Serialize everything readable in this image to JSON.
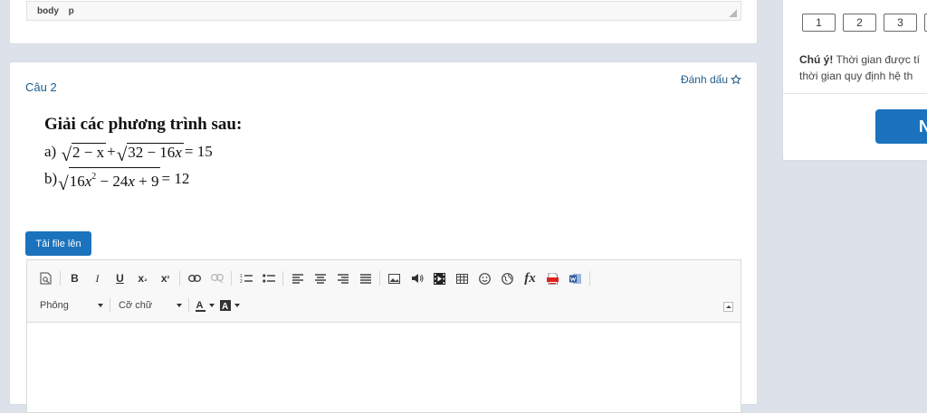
{
  "top_editor": {
    "path": [
      "body",
      "p"
    ]
  },
  "question": {
    "title": "Câu 2",
    "mark_label": "Đánh dấu",
    "heading": "Giải các phương trình sau:",
    "line_a": {
      "label": "a)",
      "r1": "2 − x",
      "plus": "+",
      "r2": "32 − 16",
      "r2_var": "x",
      "rhs": "= 15"
    },
    "line_b": {
      "label": "b)",
      "r1_a": "16",
      "r1_var": "x",
      "r1_exp": "2",
      "r1_b": " − 24",
      "r1_var2": "x",
      "r1_c": " + 9",
      "rhs": "= 12"
    }
  },
  "upload_label": "Tải file lên",
  "editor": {
    "font_combo": "Phông",
    "size_combo": "Cỡ chữ",
    "toolbar": {
      "bold": "B",
      "italic": "I",
      "underline": "U",
      "subscript": "x",
      "sub_mark": "₂",
      "superscript": "x",
      "sup_mark": "²",
      "formula": "fx"
    }
  },
  "sidebar": {
    "pages": [
      "1",
      "2",
      "3"
    ],
    "note_bold": "Chú ý!",
    "note_line1": " Thời gian được tí",
    "note_line2": "thời gian quy định hệ th",
    "primary_button": "N"
  },
  "colors": {
    "accent": "#1b73bd",
    "link": "#1f5c8b",
    "background": "#dde1ea"
  }
}
